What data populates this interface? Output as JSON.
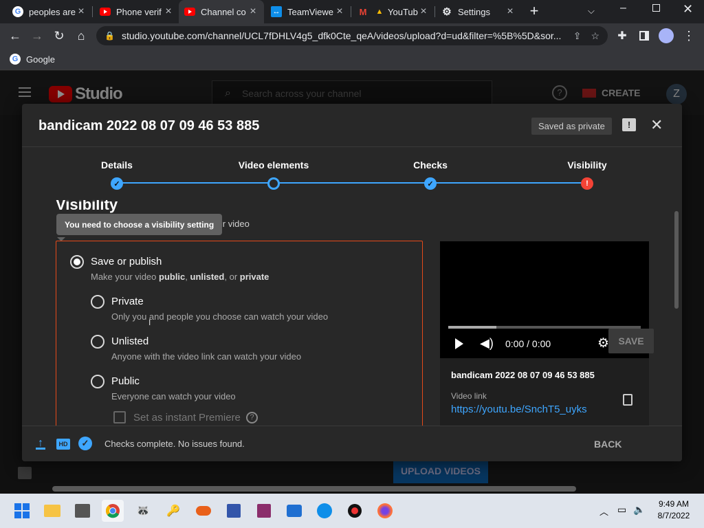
{
  "browser": {
    "tabs": [
      {
        "title": "peoples are",
        "close": "×",
        "favicon": "google-icon"
      },
      {
        "title": "Phone verif",
        "close": "×",
        "favicon": "youtube-icon"
      },
      {
        "title": "Channel co",
        "close": "×",
        "favicon": "youtube-icon"
      },
      {
        "title": "TeamViewe",
        "close": "×",
        "favicon": "teamviewer-icon"
      },
      {
        "title": "YouTub",
        "close": "×",
        "favicon": "gmail-icon"
      },
      {
        "title": "Settings",
        "close": "×",
        "favicon": "gear-icon"
      }
    ],
    "new_tab": "+",
    "url": "studio.youtube.com/channel/UCL7fDHLV4g5_dfk0Cte_qeA/videos/upload?d=ud&filter=%5B%5D&sor...",
    "bookmark": "Google"
  },
  "studio": {
    "logo": "Studio",
    "search_placeholder": "Search across your channel",
    "create": "CREATE",
    "avatar": "Z",
    "upload_videos": "UPLOAD VIDEOS"
  },
  "dialog": {
    "title": "bandicam 2022 08 07 09 46 53 885",
    "saved_badge": "Saved as private",
    "steps": [
      {
        "label": "Details",
        "state": "done"
      },
      {
        "label": "Video elements",
        "state": "current"
      },
      {
        "label": "Checks",
        "state": "done"
      },
      {
        "label": "Visibility",
        "state": "error"
      }
    ],
    "visibility_title": "Visibility",
    "visibility_subtitle_tail": "e your video",
    "tooltip": "You need to choose a visibility setting",
    "save_or_publish": "Save or publish",
    "save_desc_prefix": "Make your video ",
    "save_desc_public": "public",
    "save_desc_sep1": ", ",
    "save_desc_unlisted": "unlisted",
    "save_desc_sep2": ", or ",
    "save_desc_private": "private",
    "options": [
      {
        "label": "Private",
        "desc": "Only you and people you choose can watch your video"
      },
      {
        "label": "Unlisted",
        "desc": "Anyone with the video link can watch your video"
      },
      {
        "label": "Public",
        "desc": "Everyone can watch your video"
      }
    ],
    "premiere": "Set as instant Premiere",
    "player_time": "0:00 / 0:00",
    "preview_title": "bandicam 2022 08 07 09 46 53 885",
    "video_link_label": "Video link",
    "video_link": "https://youtu.be/SnchT5_uyks",
    "footer_status": "Checks complete. No issues found.",
    "back": "BACK",
    "save": "SAVE"
  },
  "taskbar": {
    "time": "9:49 AM",
    "date": "8/7/2022"
  },
  "colors": {
    "accent": "#3ea6ff",
    "error": "#f44336",
    "youtube_red": "#ff0000"
  }
}
